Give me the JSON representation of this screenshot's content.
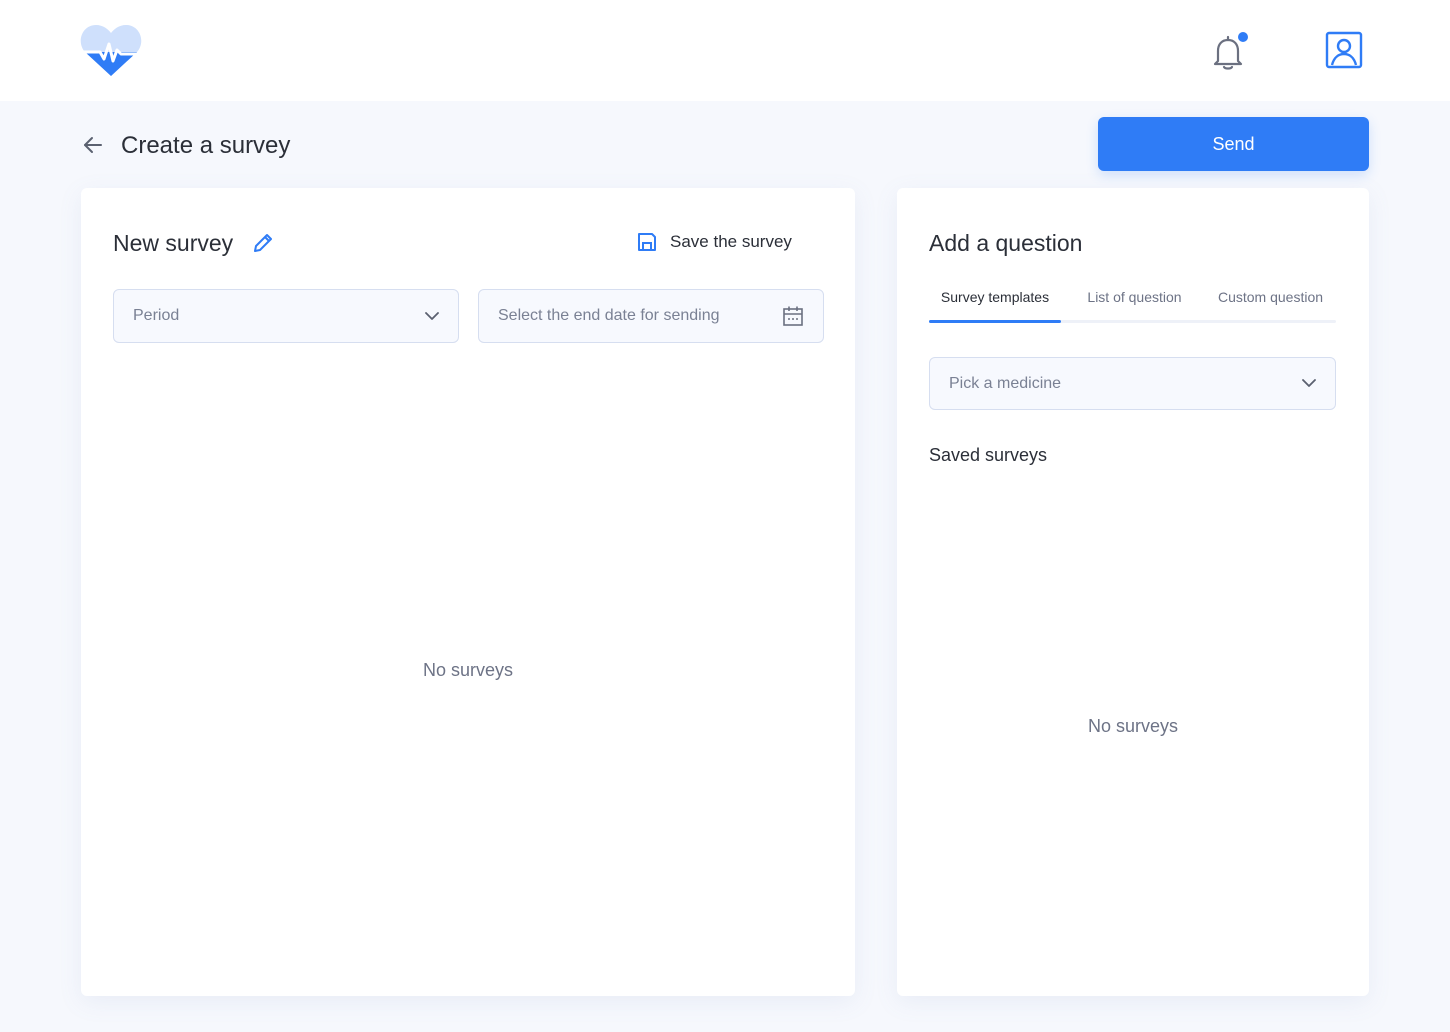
{
  "header": {
    "logo_icon": "heart-pulse-icon",
    "notification_icon": "bell-icon",
    "profile_icon": "user-profile-icon",
    "has_unread_notification": true,
    "accent_color": "#2f7cf6"
  },
  "page": {
    "title": "Create a survey",
    "back_icon": "arrow-left-icon",
    "send_label": "Send"
  },
  "survey": {
    "name": "New survey",
    "edit_icon": "pencil-icon",
    "save_label": "Save the survey",
    "save_icon": "floppy-disk-icon",
    "period_placeholder": "Period",
    "end_date_placeholder": "Select the end date for sending",
    "calendar_icon": "calendar-icon",
    "empty_text": "No surveys"
  },
  "question_panel": {
    "title": "Add a question",
    "tabs": [
      {
        "label": "Survey templates",
        "active": true
      },
      {
        "label": "List of question",
        "active": false
      },
      {
        "label": "Custom question",
        "active": false
      }
    ],
    "medicine_placeholder": "Pick a medicine",
    "saved_title": "Saved surveys",
    "empty_text": "No surveys"
  }
}
